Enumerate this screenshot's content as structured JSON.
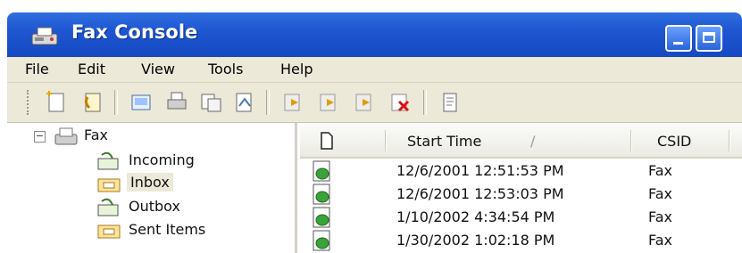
{
  "window": {
    "title": "Fax Console"
  },
  "menu": [
    "File",
    "Edit",
    "View",
    "Tools",
    "Help"
  ],
  "tree": {
    "root": "Fax",
    "items": [
      "Incoming",
      "Inbox",
      "Outbox",
      "Sent Items"
    ],
    "selected": "Inbox"
  },
  "list": {
    "columns": [
      "Start Time",
      "CSID"
    ],
    "sort_indicator": "∕",
    "rows": [
      {
        "start_time": "12/6/2001 12:51:53 PM",
        "csid": "Fax"
      },
      {
        "start_time": "12/6/2001 12:53:03 PM",
        "csid": "Fax"
      },
      {
        "start_time": "1/10/2002 4:34:54 PM",
        "csid": "Fax"
      },
      {
        "start_time": "1/30/2002 1:02:18 PM",
        "csid": "Fax"
      }
    ]
  },
  "colors": {
    "titlebar": "#1f56d1",
    "chrome": "#ece9d8",
    "selection": "#ece9d8"
  }
}
